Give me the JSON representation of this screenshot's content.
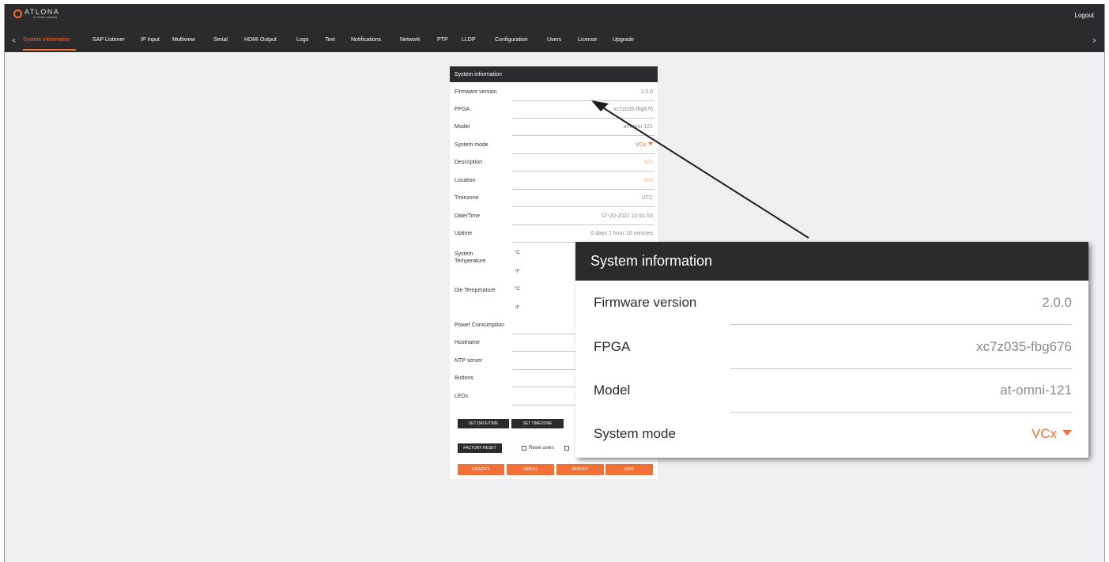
{
  "brand": {
    "name": "ATLONA",
    "sub": "A Panduit company"
  },
  "header": {
    "logout_label": "Logout"
  },
  "nav": {
    "left_arrow": "<",
    "right_arrow": ">",
    "tabs": [
      "System information",
      "SAP Listener",
      "IP Input",
      "Multiview",
      "Serial",
      "HDMI Output",
      "Logo",
      "Text",
      "Notifications",
      "Network",
      "PTP",
      "LLDP",
      "Configuration",
      "Users",
      "License",
      "Upgrade"
    ]
  },
  "panel": {
    "title": "System information",
    "rows": [
      {
        "label": "Firmware version",
        "value": "2.0.0"
      },
      {
        "label": "FPGA",
        "value": "xc7z035-fbg676"
      },
      {
        "label": "Model",
        "value": "at-omni-121"
      },
      {
        "label": "System mode",
        "value": "VCx"
      },
      {
        "label": "Description",
        "value": "N/A"
      },
      {
        "label": "Location",
        "value": "N/A"
      },
      {
        "label": "Timezone",
        "value": "UTC"
      },
      {
        "label": "Date/Time",
        "value": "07-20-2022 10:51:53"
      },
      {
        "label": "Uptime",
        "value": "0 days 1 hour 16 minutes"
      }
    ],
    "system_temperature_label": "System Temperature",
    "die_temperature_label": "Die Temperature",
    "unit_c": "°C",
    "unit_f": "°F",
    "more_rows": [
      "Power Consumption",
      "Hostname",
      "NTP server",
      "Buttons",
      "LEDs"
    ],
    "set_datetime_label": "SET DATE/TIME",
    "set_timezone_label": "SET TIMEZONE",
    "factory_reset_label": "FACTORY RESET",
    "reset_users_label": "Reset users",
    "identify_label": "IDENTIFY",
    "debug_label": "DEBUG",
    "reboot_label": "REBOOT",
    "save_label": "SAVE"
  },
  "zoom": {
    "title": "System information",
    "rows": [
      {
        "label": "Firmware version",
        "value": "2.0.0"
      },
      {
        "label": "FPGA",
        "value": "xc7z035-fbg676"
      },
      {
        "label": "Model",
        "value": "at-omni-121"
      },
      {
        "label": "System mode",
        "value": "VCx"
      }
    ]
  },
  "colors": {
    "accent": "#f26f35",
    "dark": "#2b2b2d",
    "background": "#efeef0"
  }
}
